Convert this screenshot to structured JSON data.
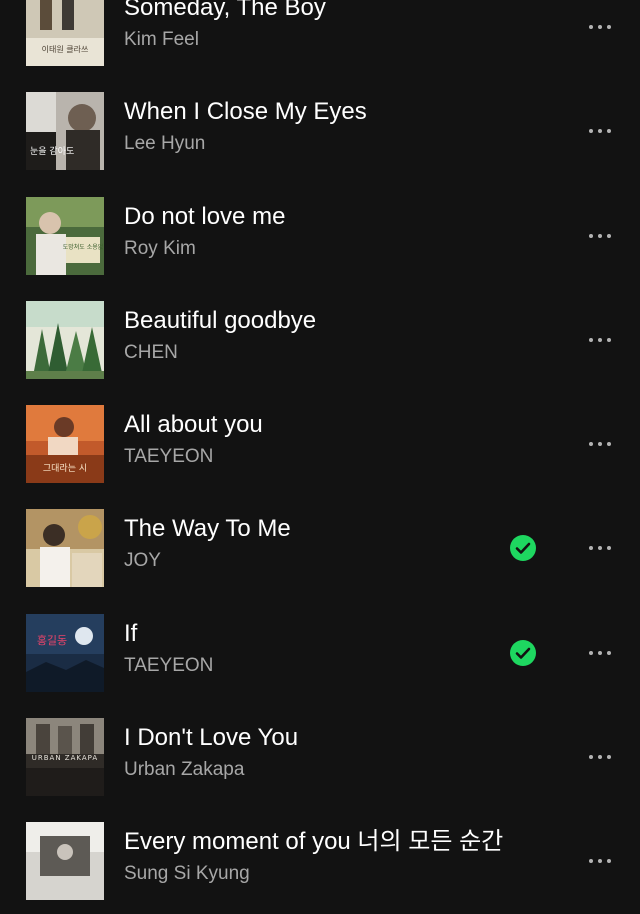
{
  "tracks": [
    {
      "title": "Someday, The Boy",
      "artist": "Kim Feel",
      "downloaded": false,
      "cover_text": "이태원 클라쓰"
    },
    {
      "title": "When I Close My Eyes",
      "artist": "Lee Hyun",
      "downloaded": false,
      "cover_text": "눈을 감아도"
    },
    {
      "title": "Do not love me",
      "artist": "Roy Kim",
      "downloaded": false,
      "cover_text": "도망쳐도 소용없"
    },
    {
      "title": "Beautiful goodbye",
      "artist": "CHEN",
      "downloaded": false,
      "cover_text": ""
    },
    {
      "title": "All about you",
      "artist": "TAEYEON",
      "downloaded": false,
      "cover_text": "그대라는 시"
    },
    {
      "title": "The Way To Me",
      "artist": "JOY",
      "downloaded": true,
      "cover_text": ""
    },
    {
      "title": "If",
      "artist": "TAEYEON",
      "downloaded": true,
      "cover_text": "홍길동"
    },
    {
      "title": "I Don't Love You",
      "artist": "Urban Zakapa",
      "downloaded": false,
      "cover_text": "URBAN ZAKAPA"
    },
    {
      "title": "Every moment of you 너의 모든 순간",
      "artist": "Sung Si Kyung",
      "downloaded": false,
      "cover_text": ""
    }
  ],
  "colors": {
    "background": "#121212",
    "title": "#ffffff",
    "artist": "#a7a7a7",
    "download_green": "#1ed760",
    "more_dots": "#b3b3b3"
  },
  "icons": {
    "downloaded": "check-circle-icon",
    "more": "more-horizontal-icon"
  }
}
